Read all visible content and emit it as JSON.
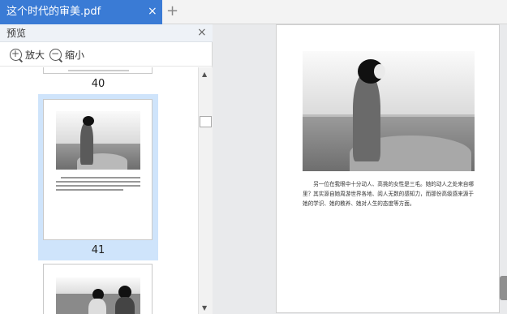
{
  "tab": {
    "title": "这个时代的审美.pdf",
    "close": "×",
    "add": "+"
  },
  "panel": {
    "title": "预览",
    "close": "×",
    "zoom_in": "放大",
    "zoom_out": "缩小"
  },
  "thumbnails": [
    {
      "page": "40"
    },
    {
      "page": "41"
    }
  ],
  "document": {
    "paragraph": "另一位在我眼中十分动人、高挑的女性是三毛。她的动人之处来自哪里？其实源自她周游世界各地、阅人无数的感知力，而那份高级感来源于她的学识、她的教养、她对人生的态度等方面。"
  }
}
